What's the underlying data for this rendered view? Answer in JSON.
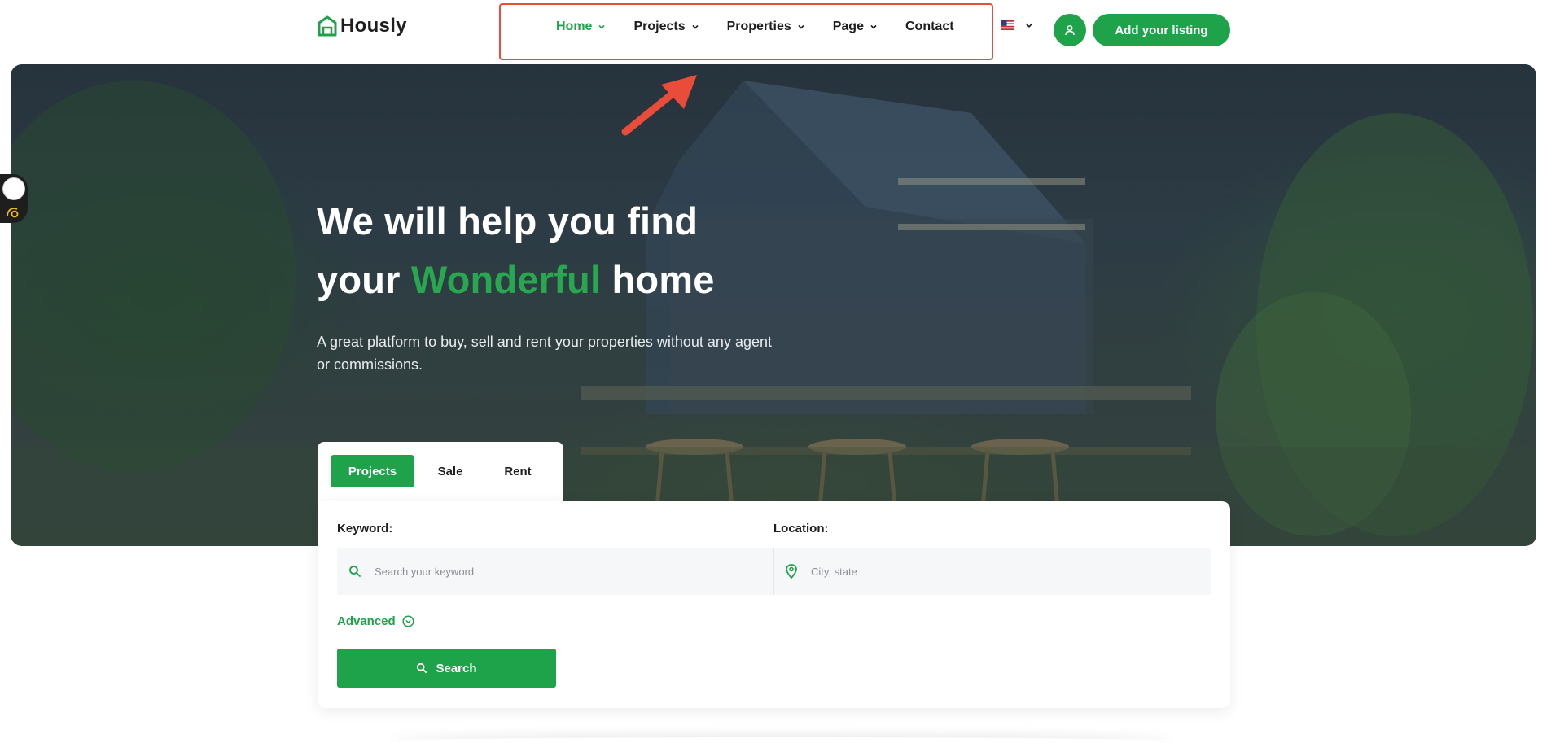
{
  "brand": {
    "name": "Hously",
    "accent": "#1ea34b"
  },
  "nav": {
    "items": [
      {
        "label": "Home",
        "has_dropdown": true,
        "active": true
      },
      {
        "label": "Projects",
        "has_dropdown": true,
        "active": false
      },
      {
        "label": "Properties",
        "has_dropdown": true,
        "active": false
      },
      {
        "label": "Page",
        "has_dropdown": true,
        "active": false
      },
      {
        "label": "Contact",
        "has_dropdown": false,
        "active": false
      }
    ],
    "language_icon": "us-flag-icon",
    "user_icon": "user-icon",
    "cta_label": "Add your listing"
  },
  "hero": {
    "title_line1": "We will help you find",
    "title_line2_pre": "your ",
    "title_line2_accent": "Wonderful",
    "title_line2_post": " home",
    "subtitle": "A great platform to buy, sell and rent your properties without any agent or commissions."
  },
  "search": {
    "tabs": [
      {
        "label": "Projects",
        "active": true
      },
      {
        "label": "Sale",
        "active": false
      },
      {
        "label": "Rent",
        "active": false
      }
    ],
    "keyword_label": "Keyword:",
    "keyword_placeholder": "Search your keyword",
    "location_label": "Location:",
    "location_placeholder": "City, state",
    "advanced_label": "Advanced",
    "search_button": "Search"
  },
  "colors": {
    "annotation": "#ea4c3a",
    "primary": "#1ea34b"
  }
}
